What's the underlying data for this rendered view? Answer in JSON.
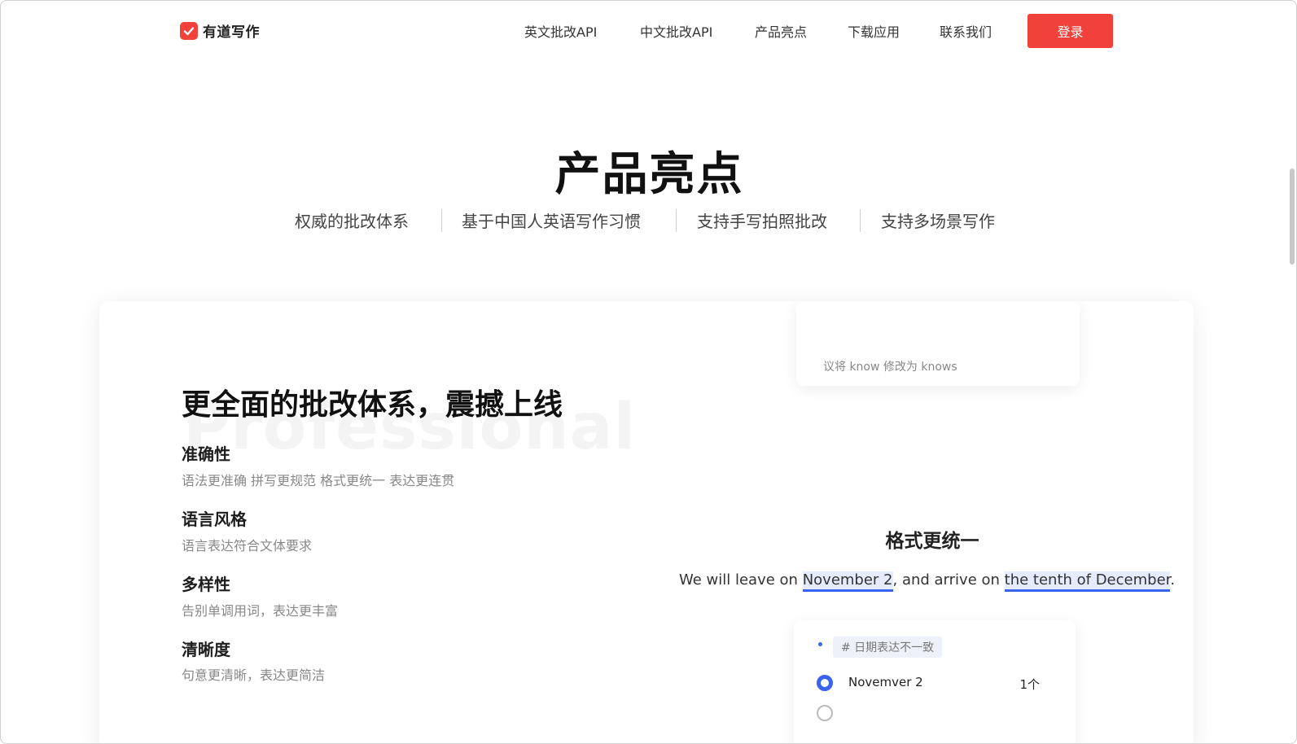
{
  "brand": {
    "name": "有道写作",
    "icon": "check-notebook-icon",
    "color": "#f0423a"
  },
  "nav": {
    "links": [
      "英文批改API",
      "中文批改API",
      "产品亮点",
      "下载应用",
      "联系我们"
    ],
    "login": "登录"
  },
  "hero": {
    "title": "产品亮点",
    "features": [
      "权威的批改体系",
      "基于中国人英语写作习惯",
      "支持手写拍照批改",
      "支持多场景写作"
    ]
  },
  "card": {
    "title": "更全面的批改体系，震撼上线",
    "watermark": "Professional",
    "items": [
      {
        "title": "准确性",
        "desc": "语法更准确 拼写更规范 格式更统一 表达更连贯"
      },
      {
        "title": "语言风格",
        "desc": "语言表达符合文体要求"
      },
      {
        "title": "多样性",
        "desc": "告别单调用词，表达更丰富"
      },
      {
        "title": "清晰度",
        "desc": "句意更清晰，表达更简洁"
      }
    ]
  },
  "demo": {
    "top_hint": "议将 know 修改为 knows",
    "format_title": "格式更统一",
    "sentence": {
      "part1": "We will leave on ",
      "hl1": "November 2",
      "part2": ", and arrive on ",
      "hl2": "the tenth of December",
      "part3": "."
    },
    "panel": {
      "tag": "# 日期表达不一致",
      "option": "Novemver 2",
      "count": "1个"
    },
    "accent": "#3a64f0"
  }
}
